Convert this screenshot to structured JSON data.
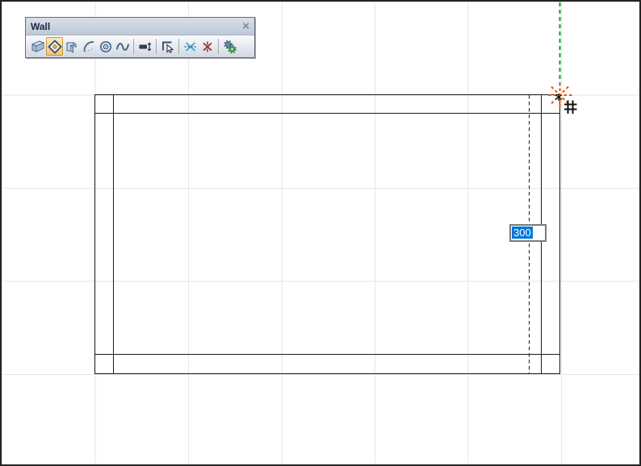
{
  "toolbar": {
    "title": "Wall",
    "close_glyph": "×",
    "tools": [
      {
        "name": "straight-wall",
        "selected": false
      },
      {
        "name": "rectangular-wall",
        "selected": true
      },
      {
        "name": "corner-wall",
        "selected": false
      },
      {
        "name": "curved-wall",
        "selected": false
      },
      {
        "name": "circular-wall",
        "selected": false
      },
      {
        "name": "spline-wall",
        "selected": false
      },
      {
        "name": "wall-width",
        "selected": false
      },
      {
        "name": "reference-line-position",
        "selected": false
      },
      {
        "name": "snap-intersection",
        "selected": false
      },
      {
        "name": "break-intersection",
        "selected": false
      },
      {
        "name": "wall-settings",
        "selected": false
      }
    ]
  },
  "canvas": {
    "tracker": {
      "value": "300"
    },
    "colors": {
      "guide_green": "#00a328",
      "snap_marker_orange": "#e8560e",
      "selection_blue": "#0078d7",
      "wall_line": "#1c1c1c",
      "grid_line": "#e6e6ee"
    }
  }
}
